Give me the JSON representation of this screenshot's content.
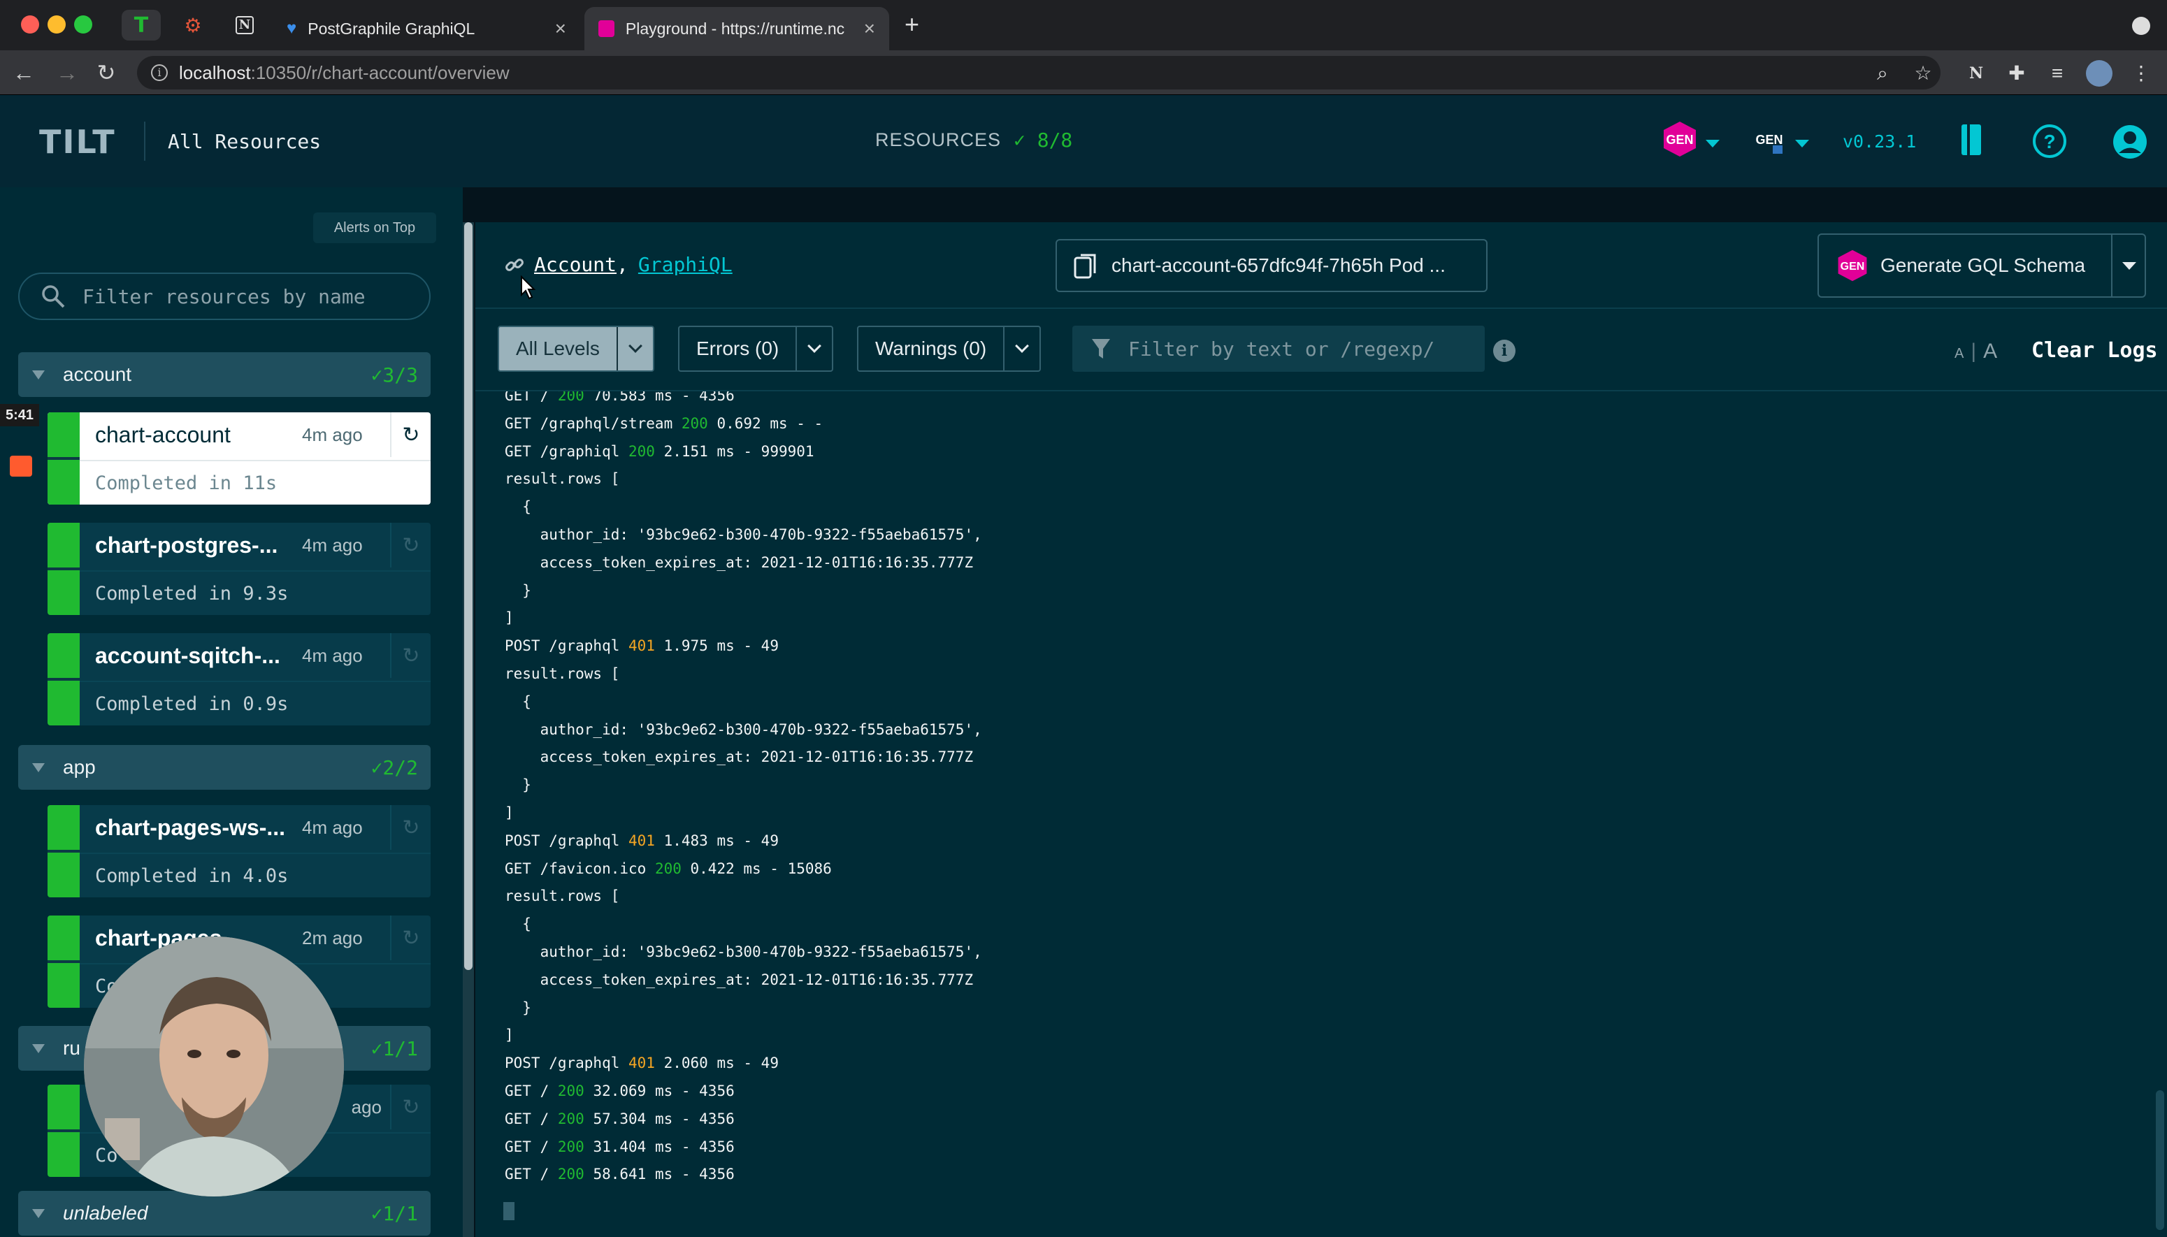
{
  "browser": {
    "tabs": [
      {
        "title": "PostGraphile GraphiQL"
      },
      {
        "title": "Playground - https://runtime.nc"
      }
    ],
    "url_host": "localhost",
    "url_path": ":10350/r/chart-account/overview"
  },
  "header": {
    "logo": "TILT",
    "all_resources": "All Resources",
    "resources_label": "RESOURCES",
    "resources_count": "✓ 8/8",
    "gen1": "GEN",
    "gen2": "GEN",
    "version": "v0.23.1"
  },
  "sidebar": {
    "alerts_on_top": "Alerts on Top",
    "search_placeholder": "Filter resources by name",
    "overlay_time": "5:41",
    "groups": [
      {
        "name": "account",
        "count": "✓3/3"
      },
      {
        "name": "app",
        "count": "✓2/2"
      },
      {
        "name": "ru",
        "count": "✓1/1"
      },
      {
        "name": "unlabeled",
        "count": "✓1/1"
      }
    ],
    "resources": [
      {
        "name": "chart-account",
        "time": "4m ago",
        "status": "Completed in 11s"
      },
      {
        "name": "chart-postgres-...",
        "time": "4m ago",
        "status": "Completed in 9.3s"
      },
      {
        "name": "account-sqitch-...",
        "time": "4m ago",
        "status": "Completed in 0.9s"
      },
      {
        "name": "chart-pages-ws-...",
        "time": "4m ago",
        "status": "Completed in 4.0s"
      },
      {
        "name": "chart-pages",
        "time": "2m ago",
        "status": "Co"
      },
      {
        "name": "",
        "time": "ago",
        "status": "Co"
      }
    ]
  },
  "main": {
    "link1": "Account",
    "link_sep": ",",
    "link2": "GraphiQL",
    "pod": "chart-account-657dfc94f-7h65h Pod ...",
    "gql_badge": "GEN",
    "gql_label": "Generate GQL Schema",
    "filters": {
      "all_levels": "All Levels",
      "errors": "Errors (0)",
      "warnings": "Warnings (0)",
      "text_placeholder": "Filter by text or /regexp/"
    },
    "font_small": "A",
    "font_sep": "|",
    "font_large": "A",
    "clear_logs": "Clear Logs"
  },
  "logs": [
    {
      "a": "GET / ",
      "code": "200",
      "b": " 70.583 ms - 4356"
    },
    {
      "a": "GET /graphql/stream ",
      "code": "200",
      "b": " 0.692 ms - -"
    },
    {
      "a": "GET /graphiql ",
      "code": "200",
      "b": " 2.151 ms - 999901"
    },
    {
      "a": "result.rows [",
      "code": "",
      "b": ""
    },
    {
      "a": "  {",
      "code": "",
      "b": ""
    },
    {
      "a": "    author_id: '93bc9e62-b300-470b-9322-f55aeba61575',",
      "code": "",
      "b": ""
    },
    {
      "a": "    access_token_expires_at: 2021-12-01T16:16:35.777Z",
      "code": "",
      "b": ""
    },
    {
      "a": "  }",
      "code": "",
      "b": ""
    },
    {
      "a": "]",
      "code": "",
      "b": ""
    },
    {
      "a": "POST /graphql ",
      "code": "401",
      "b": " 1.975 ms - 49"
    },
    {
      "a": "result.rows [",
      "code": "",
      "b": ""
    },
    {
      "a": "  {",
      "code": "",
      "b": ""
    },
    {
      "a": "    author_id: '93bc9e62-b300-470b-9322-f55aeba61575',",
      "code": "",
      "b": ""
    },
    {
      "a": "    access_token_expires_at: 2021-12-01T16:16:35.777Z",
      "code": "",
      "b": ""
    },
    {
      "a": "  }",
      "code": "",
      "b": ""
    },
    {
      "a": "]",
      "code": "",
      "b": ""
    },
    {
      "a": "POST /graphql ",
      "code": "401",
      "b": " 1.483 ms - 49"
    },
    {
      "a": "GET /favicon.ico ",
      "code": "200",
      "b": " 0.422 ms - 15086"
    },
    {
      "a": "result.rows [",
      "code": "",
      "b": ""
    },
    {
      "a": "  {",
      "code": "",
      "b": ""
    },
    {
      "a": "    author_id: '93bc9e62-b300-470b-9322-f55aeba61575',",
      "code": "",
      "b": ""
    },
    {
      "a": "    access_token_expires_at: 2021-12-01T16:16:35.777Z",
      "code": "",
      "b": ""
    },
    {
      "a": "  }",
      "code": "",
      "b": ""
    },
    {
      "a": "]",
      "code": "",
      "b": ""
    },
    {
      "a": "POST /graphql ",
      "code": "401",
      "b": " 2.060 ms - 49"
    },
    {
      "a": "GET / ",
      "code": "200",
      "b": " 32.069 ms - 4356"
    },
    {
      "a": "GET / ",
      "code": "200",
      "b": " 57.304 ms - 4356"
    },
    {
      "a": "GET / ",
      "code": "200",
      "b": " 31.404 ms - 4356"
    },
    {
      "a": "GET / ",
      "code": "200",
      "b": " 58.641 ms - 4356"
    }
  ]
}
